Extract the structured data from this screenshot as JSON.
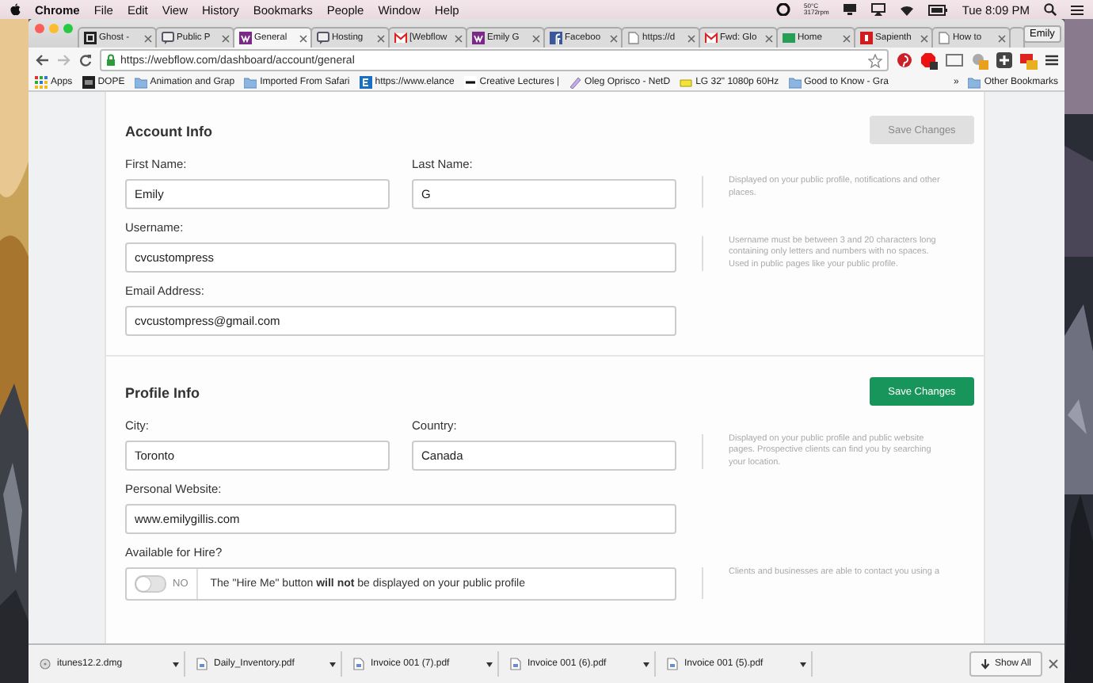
{
  "menu_bar": {
    "app": "Chrome",
    "items": [
      "File",
      "Edit",
      "View",
      "History",
      "Bookmarks",
      "People",
      "Window",
      "Help"
    ],
    "temperature": "50°C",
    "fan": "3172rpm",
    "clock": "Tue 8:09 PM"
  },
  "tabs": [
    {
      "label": "Ghost -",
      "kind": "ghost",
      "selected": false
    },
    {
      "label": "Public P",
      "kind": "chat",
      "selected": false
    },
    {
      "label": "General",
      "kind": "webflow",
      "selected": true
    },
    {
      "label": "Hosting",
      "kind": "chat",
      "selected": false
    },
    {
      "label": "[Webflow",
      "kind": "gmail",
      "selected": false
    },
    {
      "label": "Emily G",
      "kind": "webflow",
      "selected": false
    },
    {
      "label": "Faceboo",
      "kind": "facebook",
      "selected": false
    },
    {
      "label": "https://d",
      "kind": "page",
      "selected": false
    },
    {
      "label": "Fwd: Glo",
      "kind": "gmail",
      "selected": false
    },
    {
      "label": "Home",
      "kind": "green",
      "selected": false
    },
    {
      "label": "Sapienth",
      "kind": "red",
      "selected": false
    },
    {
      "label": "How to",
      "kind": "page",
      "selected": false
    }
  ],
  "profile": "Emily",
  "address": {
    "url": "https://webflow.com/dashboard/account/general"
  },
  "bookmarks": [
    {
      "label": "Apps",
      "kind": "apps"
    },
    {
      "label": "DOPE",
      "kind": "square"
    },
    {
      "label": "Animation and Grap",
      "kind": "folder"
    },
    {
      "label": "Imported From Safari",
      "kind": "folder"
    },
    {
      "label": "https://www.elance",
      "kind": "letter"
    },
    {
      "label": "Creative Lectures |",
      "kind": "dash"
    },
    {
      "label": "Oleg Oprisco - NetD",
      "kind": "pen"
    },
    {
      "label": "LG 32\" 1080p 60Hz",
      "kind": "tag"
    },
    {
      "label": "Good to Know - Gra",
      "kind": "folder"
    }
  ],
  "bookmarks_more": "»",
  "other_bookmarks": "Other Bookmarks",
  "sections": [
    {
      "title": "Account Info",
      "save": {
        "label": "Save Changes",
        "disabled": true
      },
      "rows": [
        {
          "kind": "pair",
          "fields": [
            {
              "label": "First Name:",
              "value": "Emily"
            },
            {
              "label": "Last Name:",
              "value": "G"
            }
          ],
          "help": "Displayed on your public profile, notifications and other places."
        },
        {
          "kind": "single",
          "fields": [
            {
              "label": "Username:",
              "value": "cvcustompress"
            }
          ],
          "help": "Username must be between 3 and 20 characters long containing only letters and numbers with no spaces. Used in public pages like your public profile."
        },
        {
          "kind": "single",
          "fields": [
            {
              "label": "Email Address:",
              "value": "cvcustompress@gmail.com"
            }
          ]
        }
      ]
    },
    {
      "title": "Profile Info",
      "save": {
        "label": "Save Changes",
        "disabled": false
      },
      "rows": [
        {
          "kind": "pair",
          "fields": [
            {
              "label": "City:",
              "value": "Toronto"
            },
            {
              "label": "Country:",
              "value": "Canada"
            }
          ],
          "help": "Displayed on your public profile and public website pages. Prospective clients can find you by searching your location."
        },
        {
          "kind": "single",
          "fields": [
            {
              "label": "Personal Website:",
              "value": "www.emilygillis.com"
            }
          ]
        },
        {
          "kind": "toggle",
          "label": "Available for Hire?",
          "toggle": {
            "label": "NO",
            "on": false
          },
          "text": "The \"Hire Me\" button **will not** be displayed on your public profile",
          "help": "Clients and businesses are able to contact you using a"
        }
      ]
    }
  ],
  "downloads": [
    {
      "name": "itunes12.2.dmg",
      "kind": "disk"
    },
    {
      "name": "Daily_Inventory.pdf",
      "kind": "pdf"
    },
    {
      "name": "Invoice 001 (7).pdf",
      "kind": "pdf"
    },
    {
      "name": "Invoice 001 (6).pdf",
      "kind": "pdf"
    },
    {
      "name": "Invoice 001 (5).pdf",
      "kind": "pdf"
    }
  ],
  "show_all": "Show All"
}
